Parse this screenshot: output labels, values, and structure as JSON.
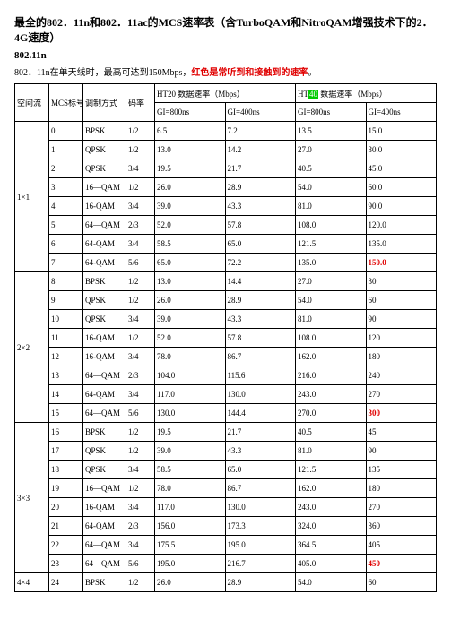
{
  "title": "最全的802．11n和802．11ac的MCS速率表（含TurboQAM和NitroQAM增强技术下的2．4G速度）",
  "section": "802.11n",
  "note_pre": "802．11n在单天线时，最高可达到150Mbps，",
  "note_red": "红色是常听到和接触到的速率",
  "note_post": "。",
  "hdr": {
    "ss": "空间流",
    "mcs": "MCS标号",
    "mod": "调制方式",
    "cr": "码率",
    "ht20": "HT20  数据速率（Mbps）",
    "ht40a": "HT",
    "ht40b": "  数据速率（Mbps）",
    "gi800": "GI=800ns",
    "gi400": "GI=400ns",
    "hl": "40"
  },
  "g": [
    {
      "ss": "1×1",
      "rows": [
        [
          "0",
          "BPSK",
          "1/2",
          "6.5",
          "7.2",
          "13.5",
          "15.0"
        ],
        [
          "1",
          "QPSK",
          "1/2",
          "13.0",
          "14.2",
          "27.0",
          "30.0"
        ],
        [
          "2",
          "QPSK",
          "3/4",
          "19.5",
          "21.7",
          "40.5",
          "45.0"
        ],
        [
          "3",
          "16—QAM",
          "1/2",
          "26.0",
          "28.9",
          "54.0",
          "60.0"
        ],
        [
          "4",
          "16-QAM",
          "3/4",
          "39.0",
          "43.3",
          "81.0",
          "90.0"
        ],
        [
          "5",
          "64—QAM",
          "2/3",
          "52.0",
          "57.8",
          "108.0",
          "120.0"
        ],
        [
          "6",
          "64-QAM",
          "3/4",
          "58.5",
          "65.0",
          "121.5",
          "135.0"
        ],
        [
          "7",
          "64-QAM",
          "5/6",
          "65.0",
          "72.2",
          "135.0",
          "150.0"
        ]
      ]
    },
    {
      "ss": "2×2",
      "rows": [
        [
          "8",
          "BPSK",
          "1/2",
          "13.0",
          "14.4",
          "27.0",
          "30"
        ],
        [
          "9",
          "QPSK",
          "1/2",
          "26.0",
          "28.9",
          "54.0",
          "60"
        ],
        [
          "10",
          "QPSK",
          "3/4",
          "39.0",
          "43.3",
          "81.0",
          "90"
        ],
        [
          "11",
          "16-QAM",
          "1/2",
          "52.0",
          "57.8",
          "108.0",
          "120"
        ],
        [
          "12",
          "16-QAM",
          "3/4",
          "78.0",
          "86.7",
          "162.0",
          "180"
        ],
        [
          "13",
          "64—QAM",
          "2/3",
          "104.0",
          "115.6",
          "216.0",
          "240"
        ],
        [
          "14",
          "64-QAM",
          "3/4",
          "117.0",
          "130.0",
          "243.0",
          "270"
        ],
        [
          "15",
          "64—QAM",
          "5/6",
          "130.0",
          "144.4",
          "270.0",
          "300"
        ]
      ]
    },
    {
      "ss": "3×3",
      "rows": [
        [
          "16",
          "BPSK",
          "1/2",
          "19.5",
          "21.7",
          "40.5",
          "45"
        ],
        [
          "17",
          "QPSK",
          "1/2",
          "39.0",
          "43.3",
          "81.0",
          "90"
        ],
        [
          "18",
          "QPSK",
          "3/4",
          "58.5",
          "65.0",
          "121.5",
          "135"
        ],
        [
          "19",
          "16—QAM",
          "1/2",
          "78.0",
          "86.7",
          "162.0",
          "180"
        ],
        [
          "20",
          "16-QAM",
          "3/4",
          "117.0",
          "130.0",
          "243.0",
          "270"
        ],
        [
          "21",
          "64-QAM",
          "2/3",
          "156.0",
          "173.3",
          "324.0",
          "360"
        ],
        [
          "22",
          "64—QAM",
          "3/4",
          "175.5",
          "195.0",
          "364.5",
          "405"
        ],
        [
          "23",
          "64—QAM",
          "5/6",
          "195.0",
          "216.7",
          "405.0",
          "450"
        ]
      ]
    },
    {
      "ss": "4×4",
      "rows": [
        [
          "24",
          "BPSK",
          "1/2",
          "26.0",
          "28.9",
          "54.0",
          "60"
        ]
      ]
    }
  ],
  "redCells": [
    "150.0",
    "300",
    "450"
  ]
}
